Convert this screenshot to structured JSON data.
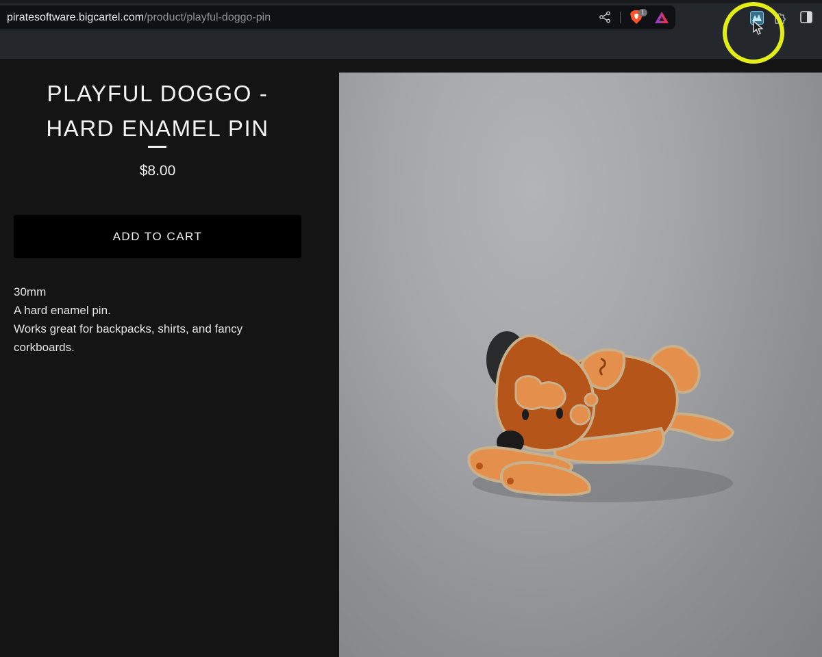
{
  "browser": {
    "url_host": "piratesoftware.bigcartel.com",
    "url_path": "/product/playful-doggo-pin",
    "shield_badge": "1",
    "icons": [
      "share-icon",
      "brave-shield-icon",
      "brave-rewards-icon",
      "extension-icon",
      "puzzle-icon",
      "sidebar-toggle-icon",
      "cursor-icon"
    ],
    "highlight_color": "#e3ee16"
  },
  "product": {
    "title": "PLAYFUL DOGGO - HARD ENAMEL PIN",
    "price": "$8.00",
    "add_to_cart_label": "ADD TO CART",
    "description": [
      "30mm",
      "A hard enamel pin.",
      "Works great for backpacks, shirts, and fancy corkboards."
    ]
  },
  "colors": {
    "page_background": "#141414",
    "button_background": "#000000",
    "pin_orange": "#e48f4c",
    "pin_dark": "#b65519"
  }
}
